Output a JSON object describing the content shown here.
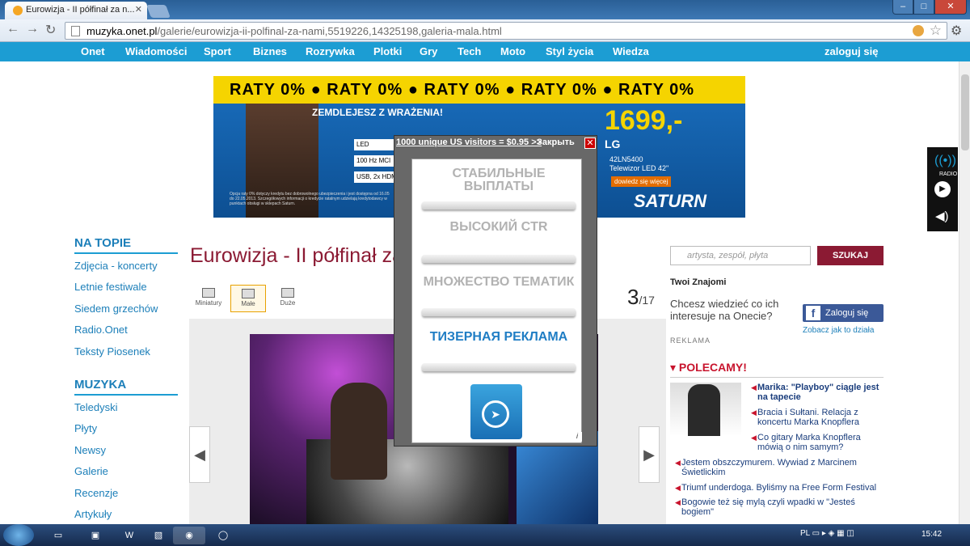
{
  "browser": {
    "tab_title": "Eurowizja - II półfinał za n...",
    "url_domain": "muzyka.onet.pl",
    "url_path": "/galerie/eurowizja-ii-polfinal-za-nami,5519226,14325198,galeria-mala.html"
  },
  "onet_nav": [
    "Onet",
    "Wiadomości",
    "Sport",
    "Biznes",
    "Rozrywka",
    "Plotki",
    "Gry",
    "Tech",
    "Moto",
    "Styl życia",
    "Wiedza"
  ],
  "login": "zaloguj się",
  "banner": {
    "raty": "RATY 0% ● RATY 0% ● RATY 0% ● RATY 0% ● RATY 0%",
    "headline": "ZEMDLEJESZ Z WRAŻENIA!",
    "features": [
      "LED",
      "100 Hz MCI",
      "USB, 2x HDMI"
    ],
    "price": "1699,-",
    "brand": "LG",
    "model": "42LN5400",
    "model_desc": "Telewizor LED 42\"",
    "cta": "dowiedz się więcej",
    "store": "SATURN",
    "fineprint": "Opcja raty 0% dotyczy kredytu bez dobrowolnego ubezpieczenia i jest dostępna od 16.05 do 22.05.2013. Szczegółowych informacji o kredycie ratalnym udzielają kredytodawcy w punktach obsługi w sklepach Saturn."
  },
  "leftnav": {
    "section1_title": "NA TOPIE",
    "section1_links": [
      "Zdjęcia - koncerty",
      "Letnie festiwale",
      "Siedem grzechów",
      "Radio.Onet",
      "Teksty Piosenek"
    ],
    "section2_title": "MUZYKA",
    "section2_links": [
      "Teledyski",
      "Płyty",
      "Newsy",
      "Galerie",
      "Recenzje",
      "Artykuły"
    ]
  },
  "article": {
    "title": "Eurowizja - II półfinał za nami"
  },
  "view_modes": [
    "Miniatury",
    "Małe",
    "Duże"
  ],
  "gallery": {
    "current": "3",
    "total": "/17"
  },
  "popup": {
    "header": "1000 unique US visitors = $0.95 >>",
    "close_label": "Закрыть",
    "close_icon": "✕",
    "items": [
      "СТАБИЛЬНЫЕ ВЫПЛАТЫ",
      "ВЫСОКИЙ CTR",
      "МНОЖЕСТВО ТЕМАТИК",
      "ТИЗЕРНАЯ РЕКЛАМА"
    ],
    "info": "i"
  },
  "sidebar": {
    "search_placeholder": "artysta, zespół, płyta",
    "search_button": "SZUKAJ",
    "znajomi": "Twoi Znajomi",
    "chcesz": "Chcesz wiedzieć co ich interesuje na Onecie?",
    "fb_button": "Zaloguj się",
    "zobacz": "Zobacz jak to działa",
    "reklama": "REKLAMA",
    "polecamy": "POLECAMY!",
    "news": [
      "Marika: \"Playboy\" ciągle jest na tapecie",
      "Bracia i Sułtani. Relacja z koncertu Marka Knopflera",
      "Co gitary Marka Knopflera mówią o nim samym?",
      "Jestem obszczymurem. Wywiad z Marcinem Świetlickim",
      "Triumf underdoga. Byliśmy na Free Form Festival",
      "Bogowie też się mylą czyli wpadki w \"Jesteś bogiem\""
    ]
  },
  "radio": {
    "label": "RADIO"
  },
  "taskbar": {
    "lang": "PL",
    "clock": "15:42"
  },
  "colors": {
    "nav": "#1c9dd3",
    "title": "#8b1a33",
    "link": "#1c7fb9",
    "accent": "#c8142d"
  }
}
